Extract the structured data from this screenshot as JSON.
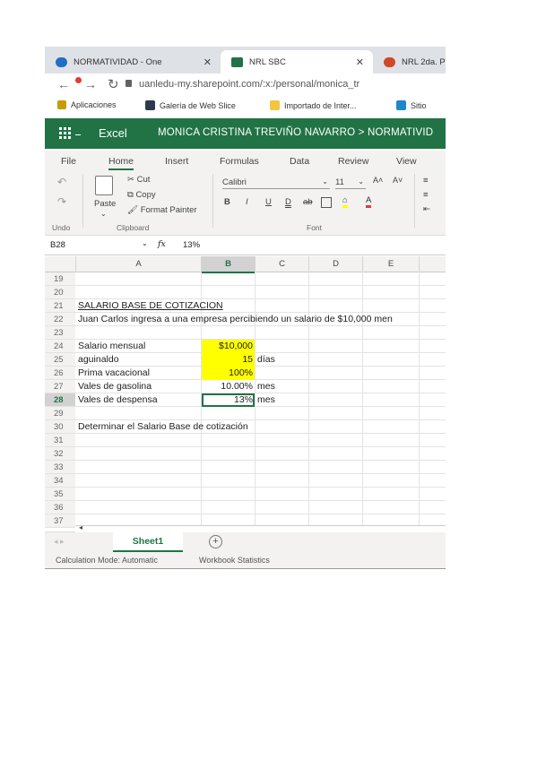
{
  "browser": {
    "tabs": [
      {
        "label": "NORMATIVIDAD - One",
        "icon": "onedrive-icon",
        "active": false
      },
      {
        "label": "NRL SBC",
        "icon": "excel-icon",
        "active": true
      },
      {
        "label": "NRL 2da. P",
        "icon": "powerpoint-icon",
        "active": false
      }
    ],
    "url": "uanledu-my.sharepoint.com/:x:/personal/monica_tr",
    "bookmarks": [
      {
        "label": "Aplicaciones",
        "icon": "apps-icon"
      },
      {
        "label": "Galería de Web Slice",
        "icon": "web-slice-icon"
      },
      {
        "label": "Importado de Inter...",
        "icon": "folder-icon"
      },
      {
        "label": "Sitio",
        "icon": "bing-icon"
      }
    ]
  },
  "excel": {
    "app_name": "Excel",
    "user_path": "MONICA CRISTINA TREVIÑO NAVARRO > NORMATIVID",
    "menu": [
      "File",
      "Home",
      "Insert",
      "Formulas",
      "Data",
      "Review",
      "View"
    ],
    "active_menu": "Home",
    "ribbon": {
      "cut": "Cut",
      "copy": "Copy",
      "paste": "Paste",
      "format_painter": "Format Painter",
      "font_name": "Calibri",
      "font_size": "11",
      "groups": {
        "undo": "Undo",
        "clipboard": "Clipboard",
        "font": "Font"
      }
    },
    "name_box": "B28",
    "formula_icon": "fx",
    "formula": "13%",
    "columns": [
      "A",
      "B",
      "C",
      "D",
      "E"
    ],
    "selected_column": "B",
    "selected_row": "28",
    "rows": [
      {
        "n": "19",
        "a": "",
        "b": "",
        "c": ""
      },
      {
        "n": "20",
        "a": "",
        "b": "",
        "c": ""
      },
      {
        "n": "21",
        "a": "SALARIO BASE DE COTIZACION",
        "b": "",
        "c": ""
      },
      {
        "n": "22",
        "a": "Juan Carlos ingresa a una empresa percibiendo un salario de $10,000 men",
        "b": "",
        "c": ""
      },
      {
        "n": "23",
        "a": "",
        "b": "",
        "c": ""
      },
      {
        "n": "24",
        "a": "Salario mensual",
        "b": "$10,000",
        "c": ""
      },
      {
        "n": "25",
        "a": "aguinaldo",
        "b": "15",
        "c": "días"
      },
      {
        "n": "26",
        "a": "Prima vacacional",
        "b": "100%",
        "c": ""
      },
      {
        "n": "27",
        "a": "Vales de gasolina",
        "b": "10.00%",
        "c": "mes"
      },
      {
        "n": "28",
        "a": "Vales de despensa",
        "b": "13%",
        "c": "mes"
      },
      {
        "n": "29",
        "a": "",
        "b": "",
        "c": ""
      },
      {
        "n": "30",
        "a": "Determinar el Salario Base de cotización",
        "b": "",
        "c": ""
      },
      {
        "n": "31",
        "a": "",
        "b": "",
        "c": ""
      },
      {
        "n": "32",
        "a": "",
        "b": "",
        "c": ""
      },
      {
        "n": "33",
        "a": "",
        "b": "",
        "c": ""
      },
      {
        "n": "34",
        "a": "",
        "b": "",
        "c": ""
      },
      {
        "n": "35",
        "a": "",
        "b": "",
        "c": ""
      },
      {
        "n": "36",
        "a": "",
        "b": "",
        "c": ""
      },
      {
        "n": "37",
        "a": "",
        "b": "",
        "c": ""
      }
    ],
    "highlight_color": "#ffff00",
    "accent_color": "#217346",
    "sheet_tab": "Sheet1",
    "add_sheet": "+",
    "status_calc": "Calculation Mode: Automatic",
    "status_stats": "Workbook Statistics"
  }
}
